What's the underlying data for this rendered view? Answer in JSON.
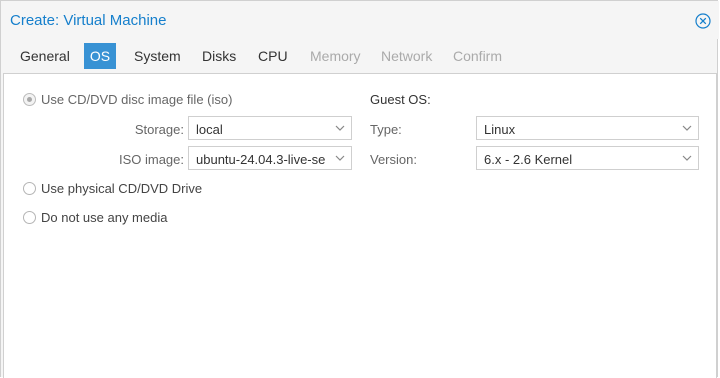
{
  "window": {
    "title": "Create: Virtual Machine",
    "close_icon": "close-circle-icon"
  },
  "tabs": [
    {
      "label": "General",
      "state": "normal"
    },
    {
      "label": "OS",
      "state": "active"
    },
    {
      "label": "System",
      "state": "normal"
    },
    {
      "label": "Disks",
      "state": "normal"
    },
    {
      "label": "CPU",
      "state": "normal"
    },
    {
      "label": "Memory",
      "state": "disabled"
    },
    {
      "label": "Network",
      "state": "disabled"
    },
    {
      "label": "Confirm",
      "state": "disabled"
    }
  ],
  "media": {
    "use_iso_label": "Use CD/DVD disc image file (iso)",
    "use_iso_checked": true,
    "storage_label": "Storage:",
    "storage_value": "local",
    "iso_label": "ISO image:",
    "iso_value": "ubuntu-24.04.3-live-se",
    "physical_label": "Use physical CD/DVD Drive",
    "no_media_label": "Do not use any media"
  },
  "guest_os": {
    "heading": "Guest OS:",
    "type_label": "Type:",
    "type_value": "Linux",
    "version_label": "Version:",
    "version_value": "6.x - 2.6 Kernel"
  },
  "colors": {
    "accent": "#157fcc",
    "active_tab": "#3892d4",
    "disabled_text": "#aaaaaa"
  }
}
